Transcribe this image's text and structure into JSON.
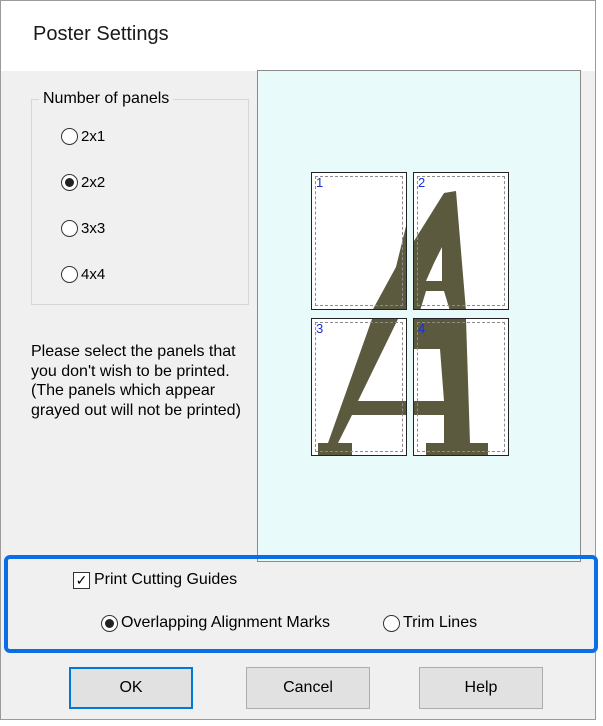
{
  "dialog": {
    "title": "Poster Settings"
  },
  "panels_group": {
    "label": "Number of panels",
    "options": [
      {
        "label": "2x1",
        "selected": false
      },
      {
        "label": "2x2",
        "selected": true
      },
      {
        "label": "3x3",
        "selected": false
      },
      {
        "label": "4x4",
        "selected": false
      }
    ]
  },
  "help_text": "Please select the panels that you don't wish to be printed. (The panels which appear grayed out will not be printed)",
  "preview": {
    "panels": [
      {
        "number": "1"
      },
      {
        "number": "2"
      },
      {
        "number": "3"
      },
      {
        "number": "4"
      }
    ]
  },
  "cutting_guides": {
    "label": "Print Cutting Guides",
    "checked": true,
    "options": [
      {
        "label": "Overlapping Alignment Marks",
        "selected": true
      },
      {
        "label": "Trim Lines",
        "selected": false
      }
    ]
  },
  "buttons": {
    "ok": "OK",
    "cancel": "Cancel",
    "help": "Help"
  },
  "colors": {
    "accent": "#0b6ee6",
    "preview_bg": "#e8fafa",
    "glyph": "#5c5a3e",
    "panel_number": "#1a2fd8"
  }
}
